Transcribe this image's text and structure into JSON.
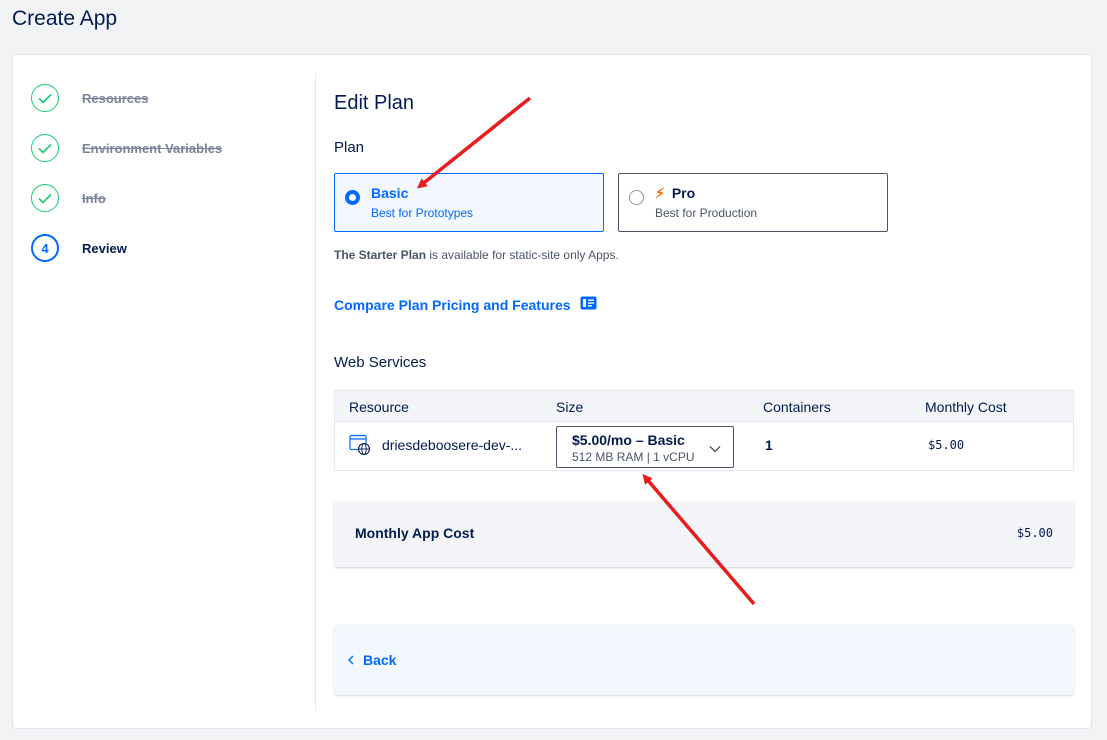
{
  "header": {
    "title": "Create App"
  },
  "stepper": {
    "steps": [
      {
        "label": "Resources",
        "state": "done"
      },
      {
        "label": "Environment Variables",
        "state": "done"
      },
      {
        "label": "Info",
        "state": "done"
      },
      {
        "label": "Review",
        "state": "current",
        "number": "4"
      }
    ]
  },
  "main": {
    "title": "Edit Plan",
    "plan_heading": "Plan",
    "plans": {
      "basic": {
        "name": "Basic",
        "description": "Best for Prototypes",
        "selected": true
      },
      "pro": {
        "name": "Pro",
        "description": "Best for Production",
        "selected": false
      }
    },
    "starter_note": {
      "bold": "The Starter Plan",
      "rest": " is available for static-site only Apps."
    },
    "compare_link": "Compare Plan Pricing and Features",
    "web_services": {
      "title": "Web Services",
      "columns": [
        "Resource",
        "Size",
        "Containers",
        "Monthly Cost"
      ],
      "row": {
        "resource": "driesdeboosere-dev-...",
        "size_main": "$5.00/mo – Basic",
        "size_sub": "512 MB RAM | 1 vCPU",
        "containers": "1",
        "cost": "$5.00"
      }
    },
    "summary": {
      "label": "Monthly App Cost",
      "value": "$5.00"
    },
    "footer": {
      "back_label": "Back"
    }
  },
  "colors": {
    "accent": "#0069ff",
    "success": "#15cd72",
    "annotation": "#e81c1c",
    "pro_bolt": "#ff6b00"
  }
}
